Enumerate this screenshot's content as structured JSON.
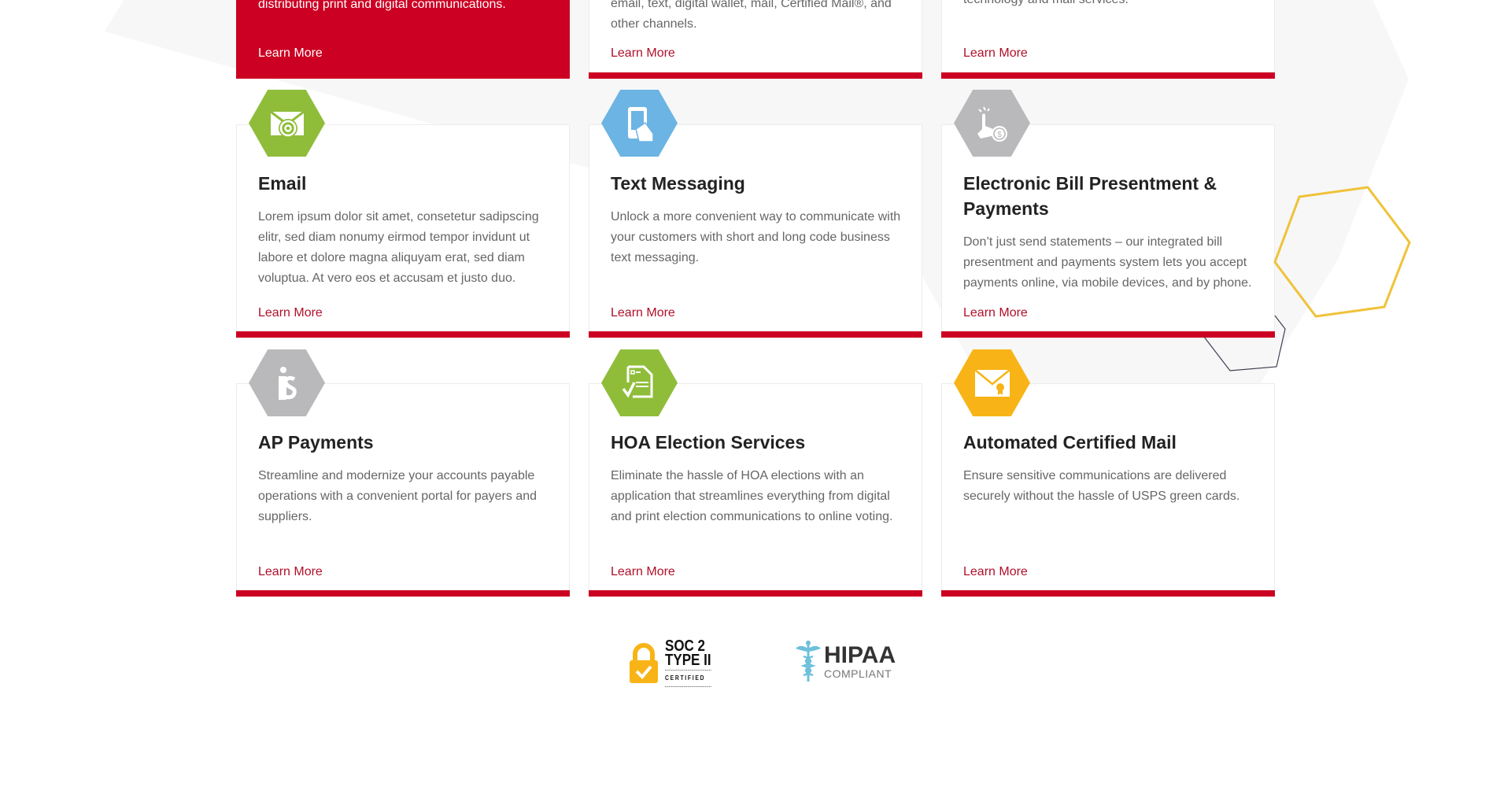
{
  "colors": {
    "brand_red": "#cc0022",
    "link_red": "#b0102a",
    "green": "#8fbd3a",
    "blue": "#6cb4e4",
    "gray": "#b9b9bb",
    "yellow": "#f8b416",
    "deco_yellow": "#f0c23a",
    "deco_dark": "#3d4050"
  },
  "top_cards": [
    {
      "desc_tail": "distributing print and digital communications.",
      "learn_more": "Learn More",
      "featured": true
    },
    {
      "desc_tail_1": "email, text, digital wallet, mail, Certified Mail®, and",
      "desc_tail_2": "other channels.",
      "learn_more": "Learn More"
    },
    {
      "desc_tail": "technology and mail services.",
      "learn_more": "Learn More"
    }
  ],
  "cards": [
    {
      "icon": "email-at-icon",
      "color": "green",
      "title": "Email",
      "description": "Lorem ipsum dolor sit amet, consetetur sadipscing elitr, sed diam nonumy eirmod tempor invidunt ut labore et dolore magna aliquyam erat, sed diam voluptua. At vero eos et accusam et justo duo.",
      "learn_more": "Learn More"
    },
    {
      "icon": "phone-in-hand-icon",
      "color": "blue",
      "title": "Text Messaging",
      "description": "Unlock a more convenient way to communicate with your customers with short and long code business text messaging.",
      "learn_more": "Learn More"
    },
    {
      "icon": "touch-pay-icon",
      "color": "gray",
      "title": "Electronic Bill Presentment & Payments",
      "description": "Don’t just send statements – our integrated bill presentment and payments system lets you accept payments online, via mobile devices, and by phone.",
      "learn_more": "Learn More"
    },
    {
      "icon": "person-dollar-icon",
      "color": "gray",
      "title": "AP Payments",
      "description": "Streamline and modernize your accounts payable operations with a convenient portal for payers and suppliers.",
      "learn_more": "Learn More"
    },
    {
      "icon": "ballot-check-icon",
      "color": "green",
      "title": "HOA Election Services",
      "description": "Eliminate the hassle of HOA elections with an application that streamlines everything from digital and print election communications to online voting.",
      "learn_more": "Learn More"
    },
    {
      "icon": "certified-mail-icon",
      "color": "yellow",
      "title": "Automated Certified Mail",
      "description": "Ensure sensitive communications are delivered securely without the hassle of USPS green cards.",
      "learn_more": "Learn More"
    }
  ],
  "certifications": {
    "soc": {
      "line1": "SOC 2",
      "line2": "TYPE II",
      "line3": "CERTIFIED"
    },
    "hipaa": {
      "line1": "HIPAA",
      "line2": "COMPLIANT"
    }
  }
}
